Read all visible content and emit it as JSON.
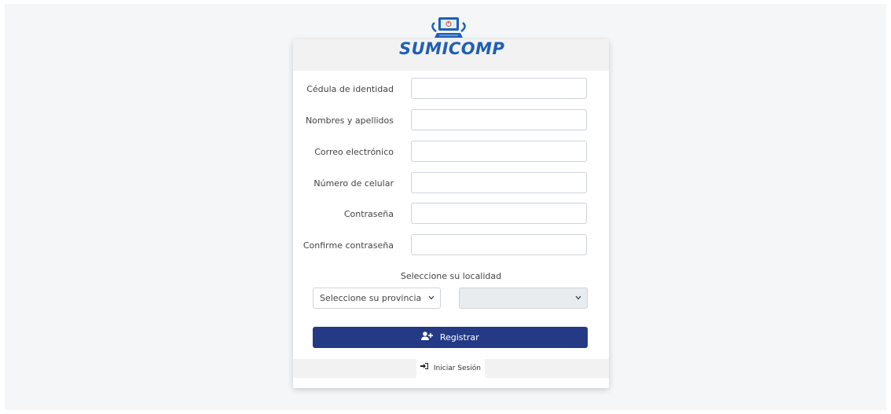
{
  "brand": {
    "name": "SUMICOMP",
    "logo_icon": "computer-power-icon"
  },
  "form": {
    "fields": [
      {
        "label": "Cédula de identidad",
        "value": ""
      },
      {
        "label": "Nombres y apellidos",
        "value": ""
      },
      {
        "label": "Correo electrónico",
        "value": ""
      },
      {
        "label": "Número de celular",
        "value": ""
      },
      {
        "label": "Contraseña",
        "value": ""
      },
      {
        "label": "Confirme contraseña",
        "value": ""
      }
    ],
    "locality_label": "Seleccione su localidad",
    "province_select": {
      "selected": "Seleccione su provincia"
    },
    "canton_select": {
      "selected": ""
    },
    "register_button": {
      "label": "Registrar",
      "icon": "user-plus-icon"
    }
  },
  "footer": {
    "login_link": {
      "label": "Iniciar Sesión",
      "icon": "sign-in-icon"
    }
  },
  "colors": {
    "primary": "#243a85",
    "brand_blue": "#1f5fb4",
    "logo_red": "#e05a3c",
    "header_bg": "#f2f2f2",
    "page_bg": "#f4f6f8"
  }
}
